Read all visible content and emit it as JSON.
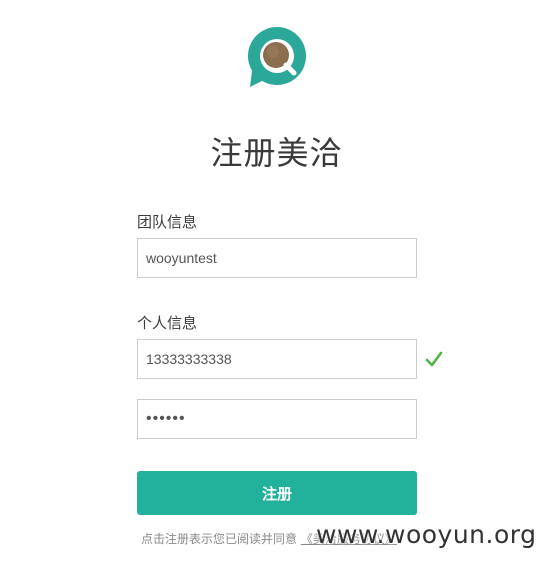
{
  "app": {
    "title": "注册美洽",
    "brand_color": "#22b29c"
  },
  "form": {
    "team_section_label": "团队信息",
    "team_name_value": "wooyuntest",
    "personal_section_label": "个人信息",
    "phone_value": "13333333338",
    "password_value": "••••••",
    "phone_valid_icon": "check-icon",
    "submit_label": "注册"
  },
  "footer": {
    "agreement_text": "点击注册表示您已阅读并同意",
    "agreement_link": "《美洽服务协议》"
  },
  "watermark": {
    "text": "www.wooyun.org"
  }
}
